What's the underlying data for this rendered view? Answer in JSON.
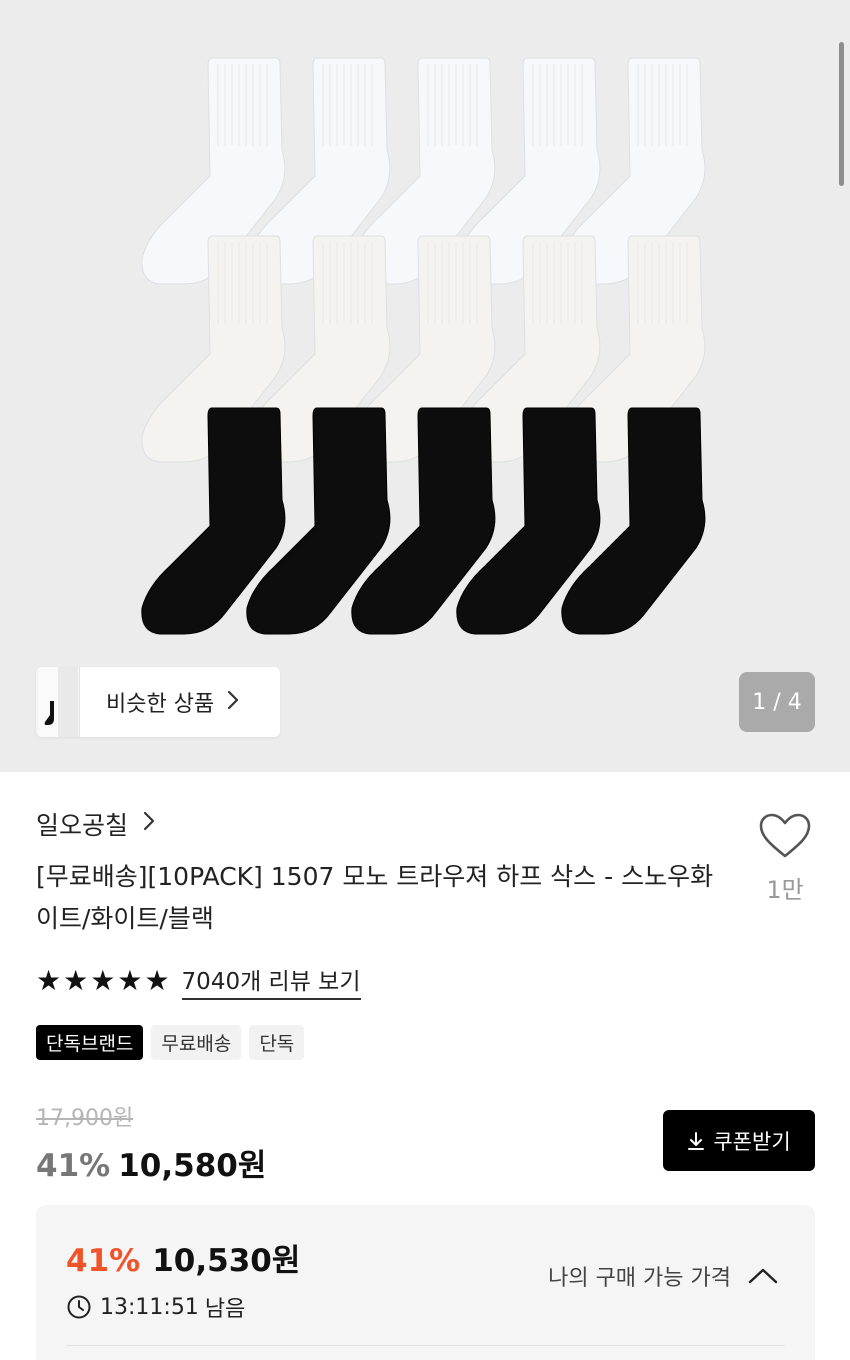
{
  "gallery": {
    "similar_label": "비슷한 상품",
    "pager": "1 / 4",
    "background_color": "#ececec",
    "sock_rows": [
      {
        "color": "#f6f8fb",
        "count": 5
      },
      {
        "color": "#f4f3ef",
        "count": 5
      },
      {
        "color": "#0d0d0d",
        "count": 5
      }
    ]
  },
  "product": {
    "brand": "일오공칠",
    "title": "[무료배송][10PACK] 1507 모노 트라우져 하프 삭스 - 스노우화이트/화이트/블랙",
    "like_count": "1만",
    "rating_stars": 5,
    "review_link": "7040개 리뷰 보기",
    "tags": [
      {
        "label": "단독브랜드",
        "style": "dark"
      },
      {
        "label": "무료배송",
        "style": "light"
      },
      {
        "label": "단독",
        "style": "light"
      }
    ]
  },
  "price": {
    "original": "17,900원",
    "discount_rate": "41%",
    "sale": "10,580원",
    "coupon_label": "쿠폰받기"
  },
  "best_price": {
    "discount_rate": "41%",
    "price": "10,530원",
    "timer": "13:11:51",
    "timer_suffix": "남음",
    "my_price_label": "나의 구매 가능 가격",
    "accent_color": "#f0532a"
  }
}
